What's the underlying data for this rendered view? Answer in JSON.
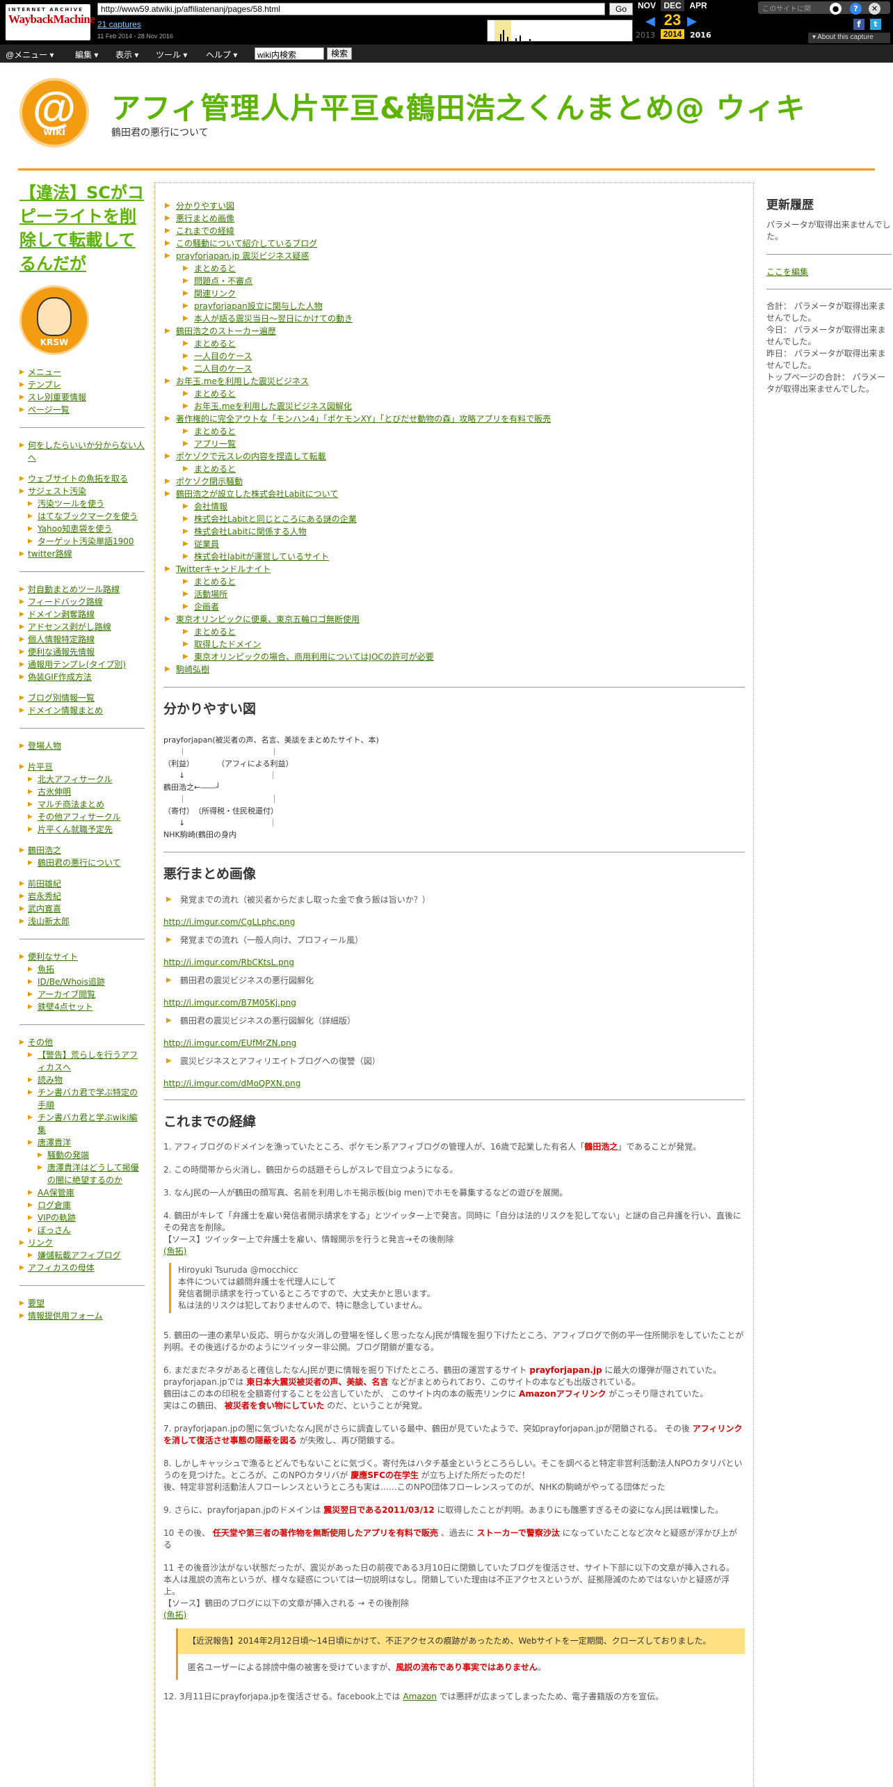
{
  "wayback": {
    "logo_top": "INTERNET ARCHIVE",
    "logo_main": "WaybackMachine",
    "url": "http://www59.atwiki.jp/affiliatenanj/pages/58.html",
    "go": "Go",
    "captures": "21 captures",
    "range": "11 Feb 2014 - 28 Nov 2016",
    "year_left": "2013",
    "months": {
      "prev": "NOV",
      "cur": "DEC",
      "next": "APR"
    },
    "day": "23",
    "years": {
      "cur": "2014",
      "next": "2016"
    },
    "right_text": "このサイトに関",
    "about": "About this capture"
  },
  "menubar": {
    "items": [
      "@メニュー ▾",
      "編集 ▾",
      "表示 ▾",
      "ツール ▾",
      "ヘルプ ▾"
    ],
    "search_value": "wiki内検索",
    "search_button": "検索"
  },
  "header": {
    "logo_at": "@",
    "logo_wiki": "wiki",
    "title": "アフィ管理人片平亘&鶴田浩之くんまとめ@ ウィキ",
    "subtitle": "鶴田君の悪行について"
  },
  "left": {
    "big_link": "【違法】SCがコピーライトを削除して転載してるんだが",
    "avatar_text": "KRSW",
    "group1": [
      "メニュー",
      "テンプレ",
      "スレ別重要情報",
      "ページ一覧"
    ],
    "group2a": [
      "何をしたらいいか分からない人へ"
    ],
    "group2b": [
      "ウェブサイトの魚拓を取る",
      "サジェスト汚染"
    ],
    "group2b_sub": [
      "汚染ツールを使う",
      "はてなブックマークを使う",
      "Yahoo知恵袋を使う",
      "ターゲット汚染単語1900"
    ],
    "group2c": [
      "twitter路線"
    ],
    "group3": [
      "対自動まとめツール路線",
      "フィードバック路線",
      "ドメイン剥奪路線",
      "アドセンス剥がし路線",
      "個人情報特定路線",
      "便利な通報先情報",
      "通報用テンプレ(タイプ別)",
      "偽装GIF作成方法"
    ],
    "group4": [
      "ブログ別情報一覧",
      "ドメイン情報まとめ"
    ],
    "group5a": [
      "登場人物"
    ],
    "group5b": [
      "片平亘"
    ],
    "group5b_sub": [
      "北大アフィサークル",
      "古氷伸明",
      "マルチ商法まとめ",
      "その他アフィサークル",
      "片平くん就職予定先"
    ],
    "group5c": [
      "鶴田浩之"
    ],
    "group5c_sub": [
      "鶴田君の悪行について"
    ],
    "group5d": [
      "前田雄紀",
      "岩永秀紀",
      "武内寛喜",
      "浅山新太郎"
    ],
    "group6": [
      "便利なサイト"
    ],
    "group6_sub": [
      "魚拓",
      "ID/Be/Whois追跡",
      "アーカイブ閲覧",
      "鉄壁4点セット"
    ],
    "group7": [
      "その他"
    ],
    "group7_sub": [
      "【警告】荒らしを行うアフィカスへ",
      "読み物",
      "チン書バカ君で学ぶ特定の手順",
      "チン書バカ君と学ぶwiki編集",
      "唐澤貴洋"
    ],
    "group7_sub2": [
      "騒動の発端",
      "唐澤貴洋はどうして掲優の闇に絶望するのか"
    ],
    "group7_sub3": [
      "AA保管庫",
      "ログ倉庫",
      "VIPの軌跡",
      "ぼっさん"
    ],
    "group7b": [
      "リンク"
    ],
    "group7b_sub": [
      "嫌儲転載アフィブログ"
    ],
    "group7c": [
      "アフィカスの母体"
    ],
    "group8": [
      "要望",
      "情報提供用フォーム"
    ]
  },
  "toc": [
    {
      "t": "分かりやすい図"
    },
    {
      "t": "悪行まとめ画像"
    },
    {
      "t": "これまでの経緯"
    },
    {
      "t": "この騒動について紹介しているブログ"
    },
    {
      "t": "prayforjapan.jp 震災ビジネス疑惑",
      "sub": [
        "まとめると",
        "問題点・不審点",
        "関連リンク",
        "prayforjapan設立に関与した人物",
        "本人が語る震災当日～翌日にかけての動き"
      ]
    },
    {
      "t": "鶴田浩之のストーカー遍歴",
      "sub": [
        "まとめると",
        "一人目のケース",
        "二人目のケース"
      ]
    },
    {
      "t": "お年玉.meを利用した震災ビジネス",
      "sub": [
        "まとめると",
        "お年玉.meを利用した震災ビジネス図解化"
      ]
    },
    {
      "t": "著作権的に完全アウトな「モンハン4」「ポケモンXY」「とびだせ動物の森」攻略アプリを有料で販売",
      "sub": [
        "まとめると",
        "アプリ一覧"
      ]
    },
    {
      "t": "ポケゾクで元スレの内容を捏造して転載",
      "sub": [
        "まとめると"
      ]
    },
    {
      "t": "ポケゾク閉示騒動"
    },
    {
      "t": "鶴田浩之が設立した株式会社Labitについて",
      "sub": [
        "会社情報",
        "株式会社Labitと同じところにある謎の企業",
        "株式会社Labitに関係する人物",
        "従業員",
        "株式会社labitが運営しているサイト"
      ]
    },
    {
      "t": "Twitterキャンドルナイト",
      "sub": [
        "まとめると",
        "活動場所",
        "企画者"
      ]
    },
    {
      "t": "東京オリンピックに便乗、東京五輪ロゴ無断使用",
      "sub": [
        "まとめると",
        "取得したドメイン",
        "東京オリンピックの場合、商用利用についてはJOCの許可が必要"
      ]
    },
    {
      "t": "駒崎弘樹"
    }
  ],
  "sec1": {
    "title": "分かりやすい図",
    "diagram": "prayforjapan(被災者の声、名言、美談をまとめたサイト、本)\n　　｜　　　　　　　　　　　｜\n（利益）　　　　（アフィによる利益）\n　　↓　　　　　　　　　　　｜\n鶴田浩之←――┘\n　　｜　　　　　　　　　　　｜\n（寄付）　（所得税・住民税還付）\n　　↓　　　　　　　　　　　｜\nNHK駒崎(鶴田の身内"
  },
  "sec2": {
    "title": "悪行まとめ画像",
    "items": [
      {
        "label": "発覚までの流れ（被災者からだまし取った金で食う飯は旨いか？）",
        "url": "http://i.imgur.com/CgLLphc.png"
      },
      {
        "label": "発覚までの流れ（一般人向け、プロフィール風）",
        "url": "http://i.imgur.com/RbCKtsL.png"
      },
      {
        "label": "鶴田君の震災ビジネスの悪行図解化",
        "url": "http://i.imgur.com/B7M05Kj.png"
      },
      {
        "label": "鶴田君の震災ビジネスの悪行図解化（詳細版）",
        "url": "http://i.imgur.com/EUfMrZN.png"
      },
      {
        "label": "震災ビジネスとアフィリエイトブログへの復讐（図）",
        "url": "http://i.imgur.com/dMoQPXN.png"
      }
    ]
  },
  "sec3": {
    "title": "これまでの経緯",
    "p1a": "1. アフィブログのドメインを漁っていたところ、ポケモン系アフィブログの管理人が、16歳で起業した有名人「",
    "p1red": "鶴田浩之",
    "p1b": "」であることが発覚。",
    "p2": "2. この時間帯から火消し、鶴田からの話題そらしがスレで目立つようになる。",
    "p3": "3. なんJ民の一人が鶴田の顔写真、名前を利用しホモ掲示板(big men)でホモを募集するなどの遊びを展開。",
    "p4": "4. 鶴田がキレて「弁護士を雇い発信者開示請求をする」とツイッター上で発言。同時に「自分は法的リスクを犯してない」と謎の自己弁護を行い、直後にその発言を削除。",
    "p4src": "【ソース】ツイッター上で弁護士を雇い、情報開示を行うと発言→その後削除",
    "p4link": "(魚拓)",
    "quote1": "Hiroyuki Tsuruda @mocchicc",
    "quote2": "本件については顧問弁護士を代理人にして",
    "quote3": "発信者開示請求を行っているところですので、大丈夫かと思います。",
    "quote4": "私は法的リスクは犯しておりませんので、特に懸念していません。",
    "p5": "5. 鶴田の一連の素早い反応、明らかな火消しの登場を怪しく思ったなんJ民が情報を掘り下げたところ、アフィブログで例の平一住所開示をしていたことが判明。その後逃げるかのようにツイッター非公開。ブログ閉鎖が重なる。",
    "p6a": "6. まだまだネタがあると確信したなんJ民が更に情報を掘り下げたところ、鶴田の運営するサイト ",
    "p6red1": "prayforjapan.jp",
    "p6b": " に最大の爆弾が隠されていた。",
    "p6c": "prayforjapan.jpでは ",
    "p6red2": "東日本大震災被災者の声、美談、名言",
    "p6d": " などがまとめられており、このサイトの本なども出版されている。",
    "p6e": "鶴田はこの本の印税を全額寄付することを公言していたが、 このサイト内の本の販売リンクに ",
    "p6red3": "Amazonアフィリンク",
    "p6f": " がこっそり隠されていた。",
    "p6g": "実はこの鶴田、 ",
    "p6red4": "被災者を食い物にしていた",
    "p6h": " のだ、ということが発覚。",
    "p7a": "7. prayforjapan.jpの闇に気づいたなんJ民がさらに調査している最中、鶴田が見ていたようで、突如prayforjapan.jpが閉鎖される。 その後 ",
    "p7red": "アフィリンクを消して復活させ事態の隠蔽を図る",
    "p7b": " が失敗し、再び閉鎖する。",
    "p8a": "8. しかしキャッシュで漁るとどんでもないことに気づく。寄付先はハタチ基金というところらしい。そこを調べると特定非営利活動法人NPOカタリバというのを見つけた。ところが、このNPOカタリバが ",
    "p8red": "慶應SFCの在学生",
    "p8b": " が立ち上げた所だったのだ！",
    "p8c": "後、特定非営利活動法人フローレンスというところも実は……このNPO団体フローレンスってのが、NHKの駒崎がやってる団体だった",
    "p9a": "9. さらに、prayforjapan.jpのドメインは ",
    "p9red": "震災翌日である2011/03/12",
    "p9b": " に取得したことが判明。あまりにも醜悪すぎるその姿になんJ民は戦慄した。",
    "p10a": "10 その後、 ",
    "p10red1": "任天堂や第三者の著作物を無断使用したアプリを有料で販売",
    "p10b": " 、過去に ",
    "p10red2": "ストーカーで警察沙汰",
    "p10c": " になっていたことなど次々と疑惑が浮かび上がる",
    "p11a": "11 その後音沙汰がない状態だったが、震災があった日の前夜である3月10日に閉鎖していたブログを復活させ、サイト下部に以下の文章が挿入される。",
    "p11b": "本人は風説の流布というが、様々な疑惑については一切説明はなし。閉鎖していた理由は不正アクセスというが、証拠隠滅のためではないかと疑惑が浮上。",
    "p11src": "【ソース】鶴田のブログに以下の文章が挿入される → その後削除",
    "p11link": "(魚拓)",
    "notice": "【近況報告】2014年2月12日頃～14日頃にかけて、不正アクセスの痕跡があったため、Webサイトを一定期間、クローズしておりました。",
    "notice2a": "匿名ユーザーによる誹謗中傷の被害を受けていますが、",
    "notice2red": "風説の流布であり事実ではありません",
    "notice2b": "。",
    "p12a": "12. 3月11日にprayforjapa.jpを復活させる。facebook上では ",
    "p12link": "Amazon",
    "p12b": " では悪評が広まってしまったため、電子書籍版の方を宣伝。"
  },
  "right": {
    "h1": "更新履歴",
    "t1": "パラメータが取得出来ませんでした。",
    "edit": "ここを編集",
    "stats": [
      "合計： パラメータが取得出来ませんでした。",
      "今日： パラメータが取得出来ませんでした。",
      "昨日： パラメータが取得出来ませんでした。",
      "トップページの合計： パラメータが取得出来ませんでした。"
    ]
  }
}
